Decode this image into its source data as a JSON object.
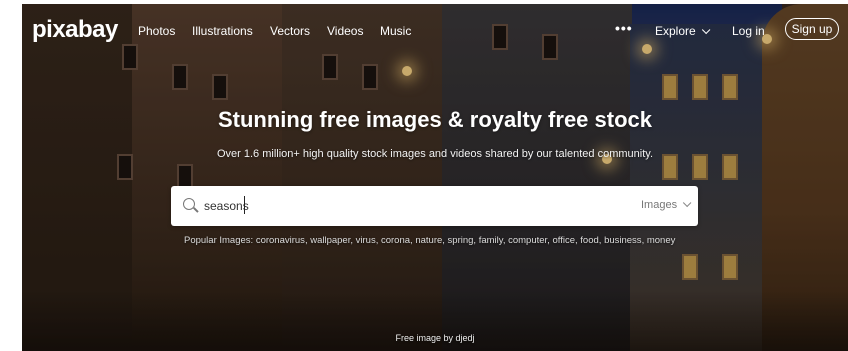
{
  "brand": {
    "logo": "pixabay"
  },
  "nav": {
    "links": [
      "Photos",
      "Illustrations",
      "Vectors",
      "Videos",
      "Music"
    ],
    "more": "•••",
    "explore": "Explore",
    "login": "Log in",
    "signup": "Sign up"
  },
  "hero": {
    "headline": "Stunning free images & royalty free stock",
    "subline": "Over 1.6 million+ high quality stock images and videos shared by our talented community."
  },
  "search": {
    "value": "seasons",
    "type": "Images"
  },
  "popular": {
    "label": "Popular Images:",
    "tags": [
      "coronavirus",
      "wallpaper",
      "virus",
      "corona",
      "nature",
      "spring",
      "family",
      "computer",
      "office",
      "food",
      "business",
      "money"
    ]
  },
  "credit": "Free image by djedj"
}
